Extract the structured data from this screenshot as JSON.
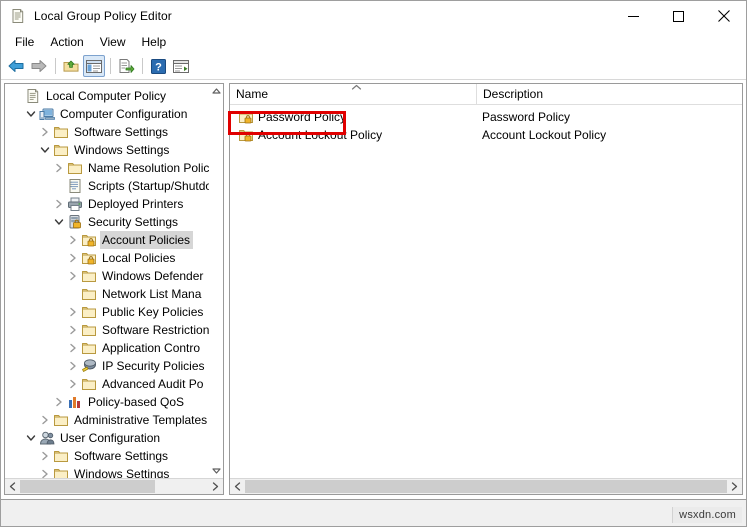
{
  "window": {
    "title": "Local Group Policy Editor",
    "icon": "policy-document-icon",
    "minimize_label": "—",
    "maximize_label": "□",
    "close_label": "✕"
  },
  "menubar": {
    "items": [
      {
        "label": "File",
        "name": "menu-file"
      },
      {
        "label": "Action",
        "name": "menu-action"
      },
      {
        "label": "View",
        "name": "menu-view"
      },
      {
        "label": "Help",
        "name": "menu-help"
      }
    ]
  },
  "toolbar": {
    "buttons": [
      {
        "icon": "back-arrow-icon",
        "title": "Back"
      },
      {
        "icon": "forward-arrow-icon",
        "title": "Forward"
      },
      {
        "icon": "up-folder-icon",
        "title": "Up One Level"
      },
      {
        "icon": "show-hide-console-tree-icon",
        "title": "Show/Hide Console Tree"
      },
      {
        "icon": "export-list-icon",
        "title": "Export List"
      },
      {
        "icon": "help-icon",
        "title": "Help"
      },
      {
        "icon": "show-action-pane-icon",
        "title": "Show/Hide Action Pane"
      }
    ]
  },
  "tree": {
    "nodes": [
      {
        "label": "Local Computer Policy",
        "indent": 0,
        "twisty": "none",
        "icon": "policy-document-icon",
        "selected": false
      },
      {
        "label": "Computer Configuration",
        "indent": 1,
        "twisty": "expanded",
        "icon": "computer-icon",
        "selected": false
      },
      {
        "label": "Software Settings",
        "indent": 2,
        "twisty": "collapsed",
        "icon": "folder-icon",
        "selected": false
      },
      {
        "label": "Windows Settings",
        "indent": 2,
        "twisty": "expanded",
        "icon": "folder-icon",
        "selected": false
      },
      {
        "label": "Name Resolution Polic",
        "indent": 3,
        "twisty": "collapsed",
        "icon": "folder-icon",
        "selected": false
      },
      {
        "label": "Scripts (Startup/Shutdo",
        "indent": 3,
        "twisty": "none",
        "icon": "script-icon",
        "selected": false
      },
      {
        "label": "Deployed Printers",
        "indent": 3,
        "twisty": "collapsed",
        "icon": "printer-icon",
        "selected": false
      },
      {
        "label": "Security Settings",
        "indent": 3,
        "twisty": "expanded",
        "icon": "security-settings-icon",
        "selected": false
      },
      {
        "label": "Account Policies",
        "indent": 4,
        "twisty": "collapsed",
        "icon": "folder-lock-icon",
        "selected": true
      },
      {
        "label": "Local Policies",
        "indent": 4,
        "twisty": "collapsed",
        "icon": "folder-lock-icon",
        "selected": false
      },
      {
        "label": "Windows Defender",
        "indent": 4,
        "twisty": "collapsed",
        "icon": "folder-icon",
        "selected": false
      },
      {
        "label": "Network List Mana",
        "indent": 4,
        "twisty": "none",
        "icon": "folder-icon",
        "selected": false
      },
      {
        "label": "Public Key Policies",
        "indent": 4,
        "twisty": "collapsed",
        "icon": "folder-icon",
        "selected": false
      },
      {
        "label": "Software Restriction",
        "indent": 4,
        "twisty": "collapsed",
        "icon": "folder-icon",
        "selected": false
      },
      {
        "label": "Application Contro",
        "indent": 4,
        "twisty": "collapsed",
        "icon": "folder-icon",
        "selected": false
      },
      {
        "label": "IP Security Policies",
        "indent": 4,
        "twisty": "collapsed",
        "icon": "ip-security-icon",
        "selected": false
      },
      {
        "label": "Advanced Audit Po",
        "indent": 4,
        "twisty": "collapsed",
        "icon": "folder-icon",
        "selected": false
      },
      {
        "label": "Policy-based QoS",
        "indent": 3,
        "twisty": "collapsed",
        "icon": "qos-chart-icon",
        "selected": false
      },
      {
        "label": "Administrative Templates",
        "indent": 2,
        "twisty": "collapsed",
        "icon": "folder-icon",
        "selected": false
      },
      {
        "label": "User Configuration",
        "indent": 1,
        "twisty": "expanded",
        "icon": "user-icon",
        "selected": false
      },
      {
        "label": "Software Settings",
        "indent": 2,
        "twisty": "collapsed",
        "icon": "folder-icon",
        "selected": false
      },
      {
        "label": "Windows Settings",
        "indent": 2,
        "twisty": "collapsed",
        "icon": "folder-icon",
        "selected": false
      }
    ],
    "scrollbars": {
      "vertical_up": "scroll-up-icon",
      "vertical_down": "scroll-down-icon",
      "horizontal_left": "scroll-left-icon",
      "horizontal_right": "scroll-right-icon"
    }
  },
  "listview": {
    "columns": [
      {
        "label": "Name",
        "sorted": "ascending"
      },
      {
        "label": "Description",
        "sorted": "none"
      }
    ],
    "rows": [
      {
        "name": "Password Policy",
        "description": "Password Policy",
        "icon": "folder-lock-icon",
        "highlighted": true
      },
      {
        "name": "Account Lockout Policy",
        "description": "Account Lockout Policy",
        "icon": "folder-lock-icon",
        "highlighted": false
      }
    ]
  },
  "annotation": {
    "highlight_color": "#e00000",
    "target": "Password Policy"
  },
  "watermark": {
    "text": "wsxdn.com"
  }
}
